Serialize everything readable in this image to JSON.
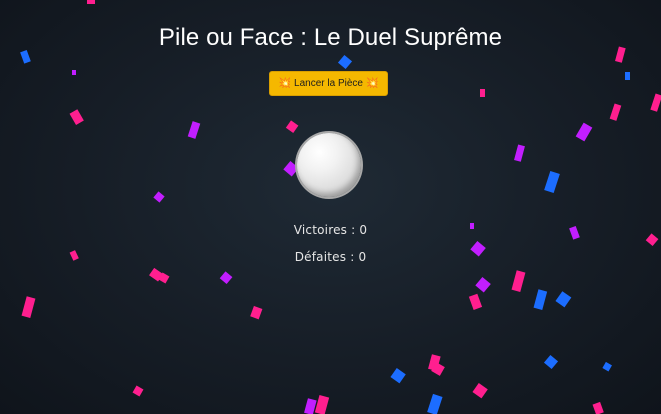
{
  "title": "Pile ou Face : Le Duel Suprême",
  "button": {
    "icon": "💥",
    "icon_name": "explosion-icon",
    "label": "Lancer la Pièce"
  },
  "coin": {
    "face": "blank",
    "color": "#e6e6e6"
  },
  "stats": {
    "wins_label": "Victoires : 0",
    "losses_label": "Défaites : 0"
  },
  "colors": {
    "background": "#161d26",
    "button": "#f5b800",
    "confetti_pink": "#ff1f8f",
    "confetti_magenta": "#c21eff",
    "confetti_blue": "#1c6dff"
  }
}
